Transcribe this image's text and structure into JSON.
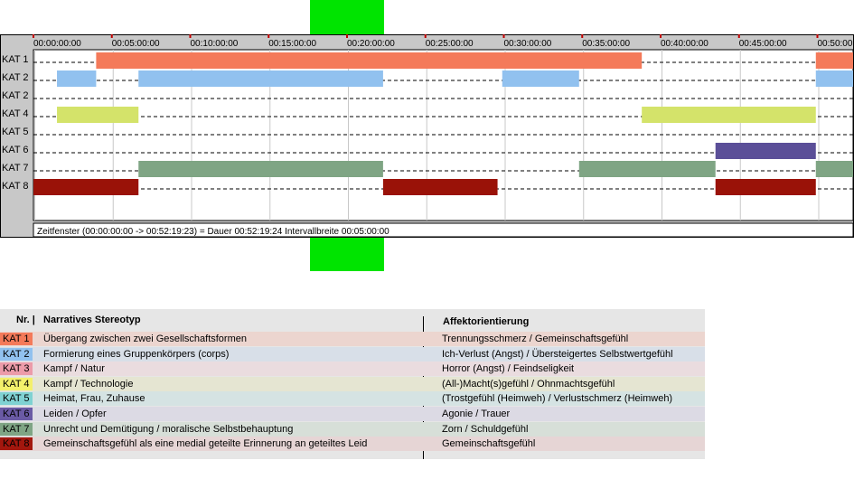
{
  "chart_data": {
    "type": "timeline",
    "x_unit": "minutes",
    "xlim": [
      0,
      52.32
    ],
    "tick_labels": [
      "00:00:00:00",
      "00:05:00:00",
      "00:10:00:00",
      "00:15:00:00",
      "00:20:00:00",
      "00:25:00:00",
      "00:30:00:00",
      "00:35:00:00",
      "00:40:00:00",
      "00:45:00:00",
      "00:50:00"
    ],
    "tick_values": [
      0,
      5,
      10,
      15,
      20,
      25,
      30,
      35,
      40,
      45,
      50
    ],
    "row_labels": [
      "KAT 1",
      "KAT 2",
      "KAT 2",
      "KAT 4",
      "KAT 5",
      "KAT 6",
      "KAT 7",
      "KAT 8"
    ],
    "series": [
      {
        "color": "#f47a5a",
        "segments": [
          [
            4.0,
            38.8
          ],
          [
            49.9,
            52.32
          ]
        ]
      },
      {
        "color": "#91c1ef",
        "segments": [
          [
            1.5,
            4.0
          ],
          [
            6.7,
            22.3
          ],
          [
            29.9,
            34.8
          ],
          [
            49.9,
            52.32
          ]
        ]
      },
      {
        "color": "#ec9ba9",
        "segments": []
      },
      {
        "color": "#d4e36a",
        "segments": [
          [
            1.5,
            6.7
          ],
          [
            38.8,
            49.9
          ]
        ]
      },
      {
        "color": "#7fd2d2",
        "segments": []
      },
      {
        "color": "#5b4f98",
        "segments": [
          [
            43.5,
            49.9
          ]
        ]
      },
      {
        "color": "#7fa584",
        "segments": [
          [
            6.7,
            22.3
          ],
          [
            34.8,
            43.5
          ],
          [
            49.9,
            52.32
          ]
        ]
      },
      {
        "color": "#9a1208",
        "segments": [
          [
            0,
            6.7
          ],
          [
            22.3,
            29.6
          ],
          [
            43.5,
            49.9
          ]
        ]
      }
    ],
    "footer": "Zeitfenster (00:00:00:00 -> 00:52:19:23) = Dauer 00:52:19:24    Intervallbreite 00:05:00:00"
  },
  "legend": {
    "headers": {
      "nr": "Nr. |",
      "stereotyp": "Narratives Stereotyp",
      "affekt": "Affektorientierung"
    },
    "rows": [
      {
        "badge": "KAT 1",
        "color": "#f47a5a",
        "bg": "#ecd5cf",
        "stereotyp": "Übergang zwischen zwei Gesellschaftsformen",
        "affekt": "Trennungsschmerz / Gemeinschaftsgefühl"
      },
      {
        "badge": "KAT 2",
        "color": "#91c1ef",
        "bg": "#d8dfe8",
        "stereotyp": "Formierung eines Gruppenkörpers (corps)",
        "affekt": "Ich-Verlust (Angst) / Übersteigertes Selbstwertgefühl"
      },
      {
        "badge": "KAT 3",
        "color": "#ec9ba9",
        "bg": "#eadcdf",
        "stereotyp": "Kampf / Natur",
        "affekt": "Horror (Angst) / Feindseligkeit"
      },
      {
        "badge": "KAT 4",
        "color": "#f3f06b",
        "bg": "#e5e5d2",
        "stereotyp": "Kampf / Technologie",
        "affekt": "(All-)Macht(s)gefühl / Ohnmachtsgefühl"
      },
      {
        "badge": "KAT 5",
        "color": "#7fd2d2",
        "bg": "#d5e3e3",
        "stereotyp": "Heimat, Frau, Zuhause",
        "affekt": "(Trostgefühl (Heimweh) / Verlustschmerz (Heimweh)"
      },
      {
        "badge": "KAT 6",
        "color": "#6a5aa5",
        "bg": "#dcdae4",
        "stereotyp": "Leiden / Opfer",
        "affekt": "Agonie / Trauer"
      },
      {
        "badge": "KAT 7",
        "color": "#7fa584",
        "bg": "#d7dfd8",
        "stereotyp": "Unrecht und Demütigung / moralische Selbstbehauptung",
        "affekt": "Zorn / Schuldgefühl"
      },
      {
        "badge": "KAT 8",
        "color": "#a3170e",
        "bg": "#e6d5d5",
        "stereotyp": "Gemeinschaftsgefühl als eine medial geteilte Erinnerung an geteiltes Leid",
        "affekt": "Gemeinschaftsgefühl"
      }
    ]
  }
}
